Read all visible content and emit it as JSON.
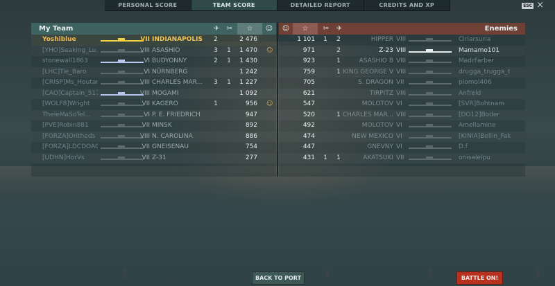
{
  "tabs": [
    "PERSONAL SCORE",
    "TEAM SCORE",
    "DETAILED REPORT",
    "CREDITS AND XP"
  ],
  "active_tab": 1,
  "esc_label": "ESC",
  "close_glyph": "×",
  "my_team": {
    "title": "My Team",
    "rows": [
      {
        "name": "Yoshiblue",
        "tier": "VII",
        "ship": "INDIANAPOLIS",
        "c1": "2",
        "c2": "",
        "score": "2 476",
        "smile": "",
        "me": true
      },
      {
        "name": "[YHO]Seaking_Lu...",
        "tier": "VIII",
        "ship": "ASASHIO",
        "c1": "3",
        "c2": "1",
        "score": "1 470",
        "smile": "☺"
      },
      {
        "name": "stonewall1863",
        "tier": "VI",
        "ship": "BUDYONNY",
        "c1": "2",
        "c2": "1",
        "score": "1 430",
        "smile": "",
        "bright": true
      },
      {
        "name": "[LHC]Tie_Baro",
        "tier": "VI",
        "ship": "NÜRNBERG",
        "c1": "",
        "c2": "",
        "score": "1 242",
        "smile": ""
      },
      {
        "name": "[CRISP]Ms_Houtar",
        "tier": "VIII",
        "ship": "CHARLES MAR...",
        "c1": "3",
        "c2": "1",
        "score": "1 227",
        "smile": ""
      },
      {
        "name": "[CAO]Captain_517",
        "tier": "VIII",
        "ship": "MOGAMI",
        "c1": "",
        "c2": "",
        "score": "1 092",
        "smile": "",
        "bright": true
      },
      {
        "name": "[WOLF8]Wright",
        "tier": "VII",
        "ship": "KAGERO",
        "c1": "1",
        "c2": "",
        "score": "956",
        "smile": "☺"
      },
      {
        "name": "TheleMaSoTel...",
        "tier": "VI",
        "ship": "P. E. FRIEDRICH",
        "c1": "",
        "c2": "",
        "score": "947",
        "smile": ""
      },
      {
        "name": "[PVE]Robin881",
        "tier": "VII",
        "ship": "MINSK",
        "c1": "",
        "c2": "",
        "score": "892",
        "smile": ""
      },
      {
        "name": "[FORZA]Oritheds",
        "tier": "VIII",
        "ship": "N. CAROLINA",
        "c1": "",
        "c2": "",
        "score": "886",
        "smile": ""
      },
      {
        "name": "[FORZA]LDCDOAG",
        "tier": "VII",
        "ship": "GNEISENAU",
        "c1": "",
        "c2": "",
        "score": "754",
        "smile": ""
      },
      {
        "name": "[UDHN]HorVs",
        "tier": "VII",
        "ship": "Z-31",
        "c1": "",
        "c2": "",
        "score": "277",
        "smile": ""
      }
    ]
  },
  "enemies": {
    "title": "Enemies",
    "rows": [
      {
        "score": "1 101",
        "c1": "1",
        "c2": "2",
        "ship": "HIPPER",
        "tier": "VIII",
        "name": "Ciriarsuria"
      },
      {
        "score": "971",
        "c1": "",
        "c2": "2",
        "ship": "Z-23",
        "tier": "VIII",
        "name": "Mamamo101",
        "white": true
      },
      {
        "score": "923",
        "c1": "",
        "c2": "1",
        "ship": "ASASHIO B",
        "tier": "VIII",
        "name": "MadrFarber"
      },
      {
        "score": "759",
        "c1": "",
        "c2": "1",
        "ship": "KING GEORGE V",
        "tier": "VIII",
        "name": "drugga_trugga_t"
      },
      {
        "score": "705",
        "c1": "",
        "c2": "",
        "ship": "S. DRAGON",
        "tier": "VII",
        "name": "plomol406"
      },
      {
        "score": "621",
        "c1": "",
        "c2": "",
        "ship": "TIRPITZ",
        "tier": "VIII",
        "name": "Anfreld"
      },
      {
        "score": "547",
        "c1": "",
        "c2": "",
        "ship": "MOLOTOV",
        "tier": "VI",
        "name": "[SVR]Bohtnam"
      },
      {
        "score": "520",
        "c1": "",
        "c2": "1",
        "ship": "CHARLES MAR...",
        "tier": "VIII",
        "name": "[DO12]Boder"
      },
      {
        "score": "492",
        "c1": "",
        "c2": "",
        "ship": "MOLOTOV",
        "tier": "VI",
        "name": "Amellamine"
      },
      {
        "score": "474",
        "c1": "",
        "c2": "",
        "ship": "NEW MEXICO",
        "tier": "VI",
        "name": "[KINIA]Bellin_Fak"
      },
      {
        "score": "447",
        "c1": "",
        "c2": "",
        "ship": "GNEVNY",
        "tier": "VI",
        "name": "D.f"
      },
      {
        "score": "431",
        "c1": "1",
        "c2": "1",
        "ship": "AKATSUKI",
        "tier": "VII",
        "name": "onisalelpu"
      }
    ]
  },
  "buttons": {
    "back": "BACK TO PORT",
    "battle": "BATTLE ON!"
  }
}
